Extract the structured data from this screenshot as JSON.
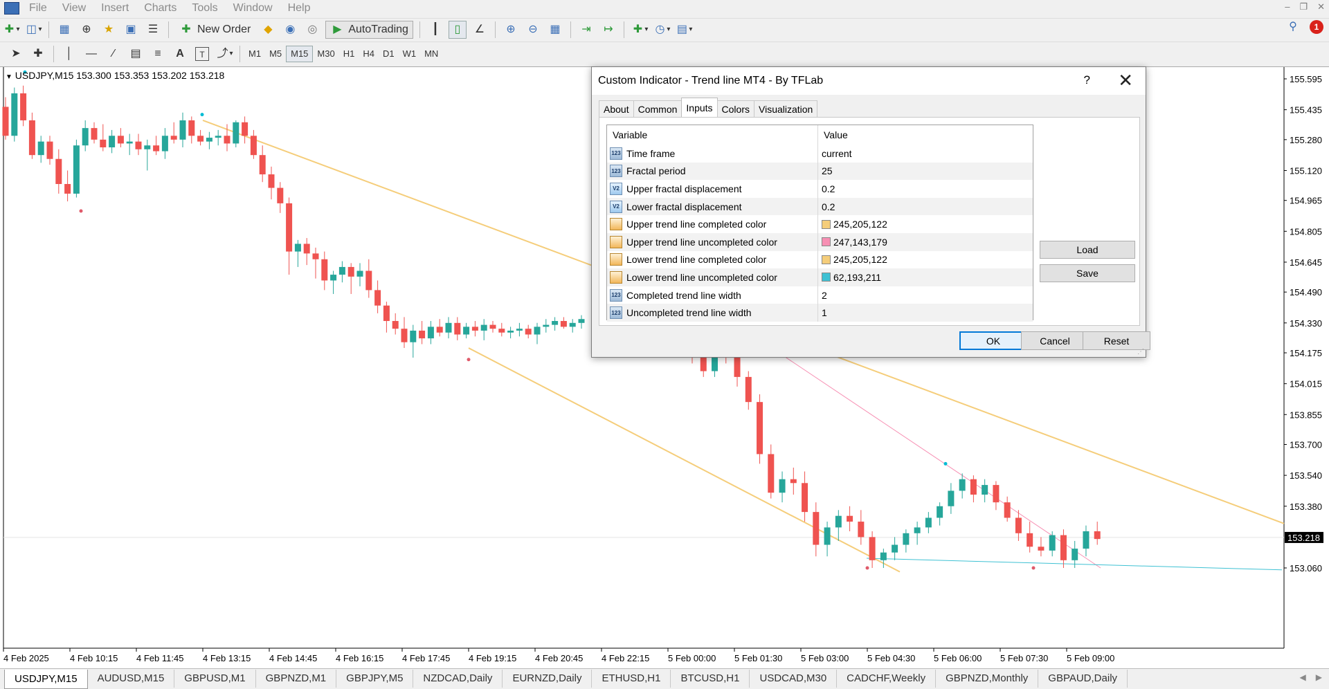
{
  "menu": [
    "File",
    "View",
    "Insert",
    "Charts",
    "Tools",
    "Window",
    "Help"
  ],
  "toolbar": {
    "new_order": "New Order",
    "auto_trading": "AutoTrading",
    "timeframes": [
      "M1",
      "M5",
      "M15",
      "M30",
      "H1",
      "H4",
      "D1",
      "W1",
      "MN"
    ],
    "active_timeframe": "M15",
    "notification_count": "1"
  },
  "chart": {
    "header": "USDJPY,M15  153.300 153.353 153.202 153.218",
    "current_price": "153.218",
    "price_axis": [
      "155.595",
      "155.435",
      "155.280",
      "155.120",
      "154.965",
      "154.805",
      "154.645",
      "154.490",
      "154.330",
      "154.175",
      "154.015",
      "153.855",
      "153.700",
      "153.540",
      "153.380",
      "153.060"
    ],
    "time_axis": [
      "4 Feb 2025",
      "4 Feb 10:15",
      "4 Feb 11:45",
      "4 Feb 13:15",
      "4 Feb 14:45",
      "4 Feb 16:15",
      "4 Feb 17:45",
      "4 Feb 19:15",
      "4 Feb 20:45",
      "4 Feb 22:15",
      "5 Feb 00:00",
      "5 Feb 01:30",
      "5 Feb 03:00",
      "5 Feb 04:30",
      "5 Feb 06:00",
      "5 Feb 07:30",
      "5 Feb 09:00"
    ],
    "colors": {
      "bull": "#26a69a",
      "bear": "#ef5350",
      "completed_line": "#f5cd7a",
      "upper_uncompleted": "#f78fb3",
      "lower_uncompleted": "#3ec1d3",
      "up_fractal": "#00bcd4",
      "down_fractal": "#e05a6a"
    }
  },
  "symbol_tabs": [
    "USDJPY,M15",
    "AUDUSD,M15",
    "GBPUSD,M1",
    "GBPNZD,M1",
    "GBPJPY,M5",
    "NZDCAD,Daily",
    "EURNZD,Daily",
    "ETHUSD,H1",
    "BTCUSD,H1",
    "USDCAD,M30",
    "CADCHF,Weekly",
    "GBPNZD,Monthly",
    "GBPAUD,Daily"
  ],
  "dialog": {
    "title": "Custom Indicator - Trend line MT4 - By TFLab",
    "help": "?",
    "tabs": [
      "About",
      "Common",
      "Inputs",
      "Colors",
      "Visualization"
    ],
    "active_tab": "Inputs",
    "table_header": {
      "variable": "Variable",
      "value": "Value"
    },
    "inputs": [
      {
        "icon": "int-icon",
        "icon_text": "123",
        "variable": "Time frame",
        "value": "current"
      },
      {
        "icon": "int-icon",
        "icon_text": "123",
        "variable": "Fractal period",
        "value": "25"
      },
      {
        "icon": "double-icon",
        "icon_text": "V2",
        "variable": "Upper fractal displacement",
        "value": "0.2"
      },
      {
        "icon": "double-icon",
        "icon_text": "V2",
        "variable": "Lower fractal displacement",
        "value": "0.2"
      },
      {
        "icon": "color-icon",
        "icon_text": "",
        "variable": "Upper trend line completed color",
        "value": "245,205,122",
        "swatch": "#f5cd7a"
      },
      {
        "icon": "color-icon",
        "icon_text": "",
        "variable": "Upper trend line uncompleted color",
        "value": "247,143,179",
        "swatch": "#f78fb3"
      },
      {
        "icon": "color-icon",
        "icon_text": "",
        "variable": "Lower trend line completed color",
        "value": "245,205,122",
        "swatch": "#f5cd7a"
      },
      {
        "icon": "color-icon",
        "icon_text": "",
        "variable": "Lower trend line uncompleted color",
        "value": "62,193,211",
        "swatch": "#3ec1d3"
      },
      {
        "icon": "int-icon",
        "icon_text": "123",
        "variable": "Completed trend line width",
        "value": "2"
      },
      {
        "icon": "int-icon",
        "icon_text": "123",
        "variable": "Uncompleted trend line width",
        "value": "1"
      }
    ],
    "load": "Load",
    "save": "Save",
    "ok": "OK",
    "cancel": "Cancel",
    "reset": "Reset"
  }
}
